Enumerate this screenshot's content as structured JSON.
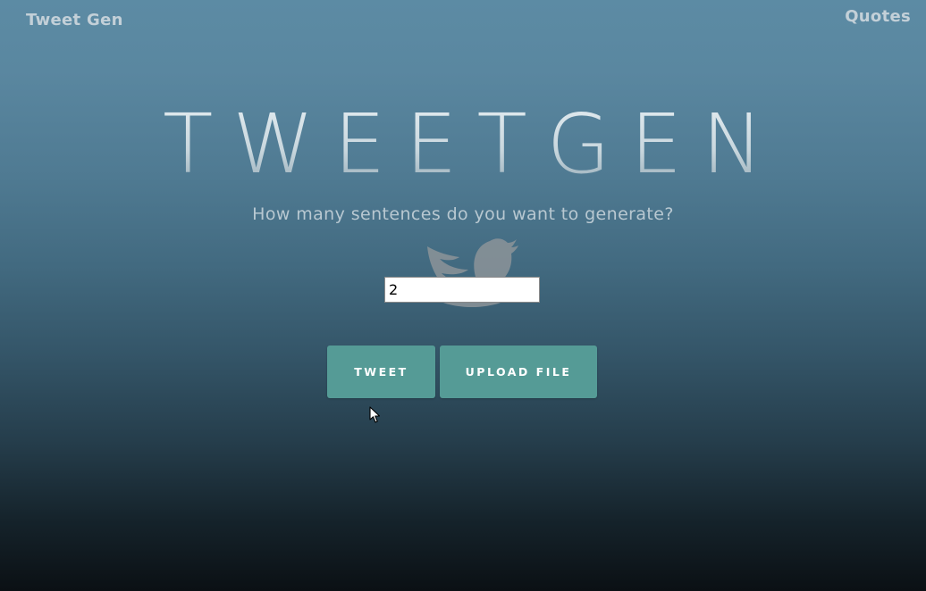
{
  "nav": {
    "brand": "Tweet Gen",
    "link": "Quotes"
  },
  "hero": {
    "title": "TWEETGEN",
    "subtitle": "How many sentences do you want to generate?"
  },
  "form": {
    "count_value": "2"
  },
  "buttons": {
    "tweet_label": "TWEET",
    "upload_label": "UPLOAD FILE"
  },
  "icons": {
    "logo": "twitter-bird-icon",
    "pointer": "mouse-cursor-icon"
  },
  "colors": {
    "button": "#559b96",
    "nav_text": "#c3d0d8",
    "background_top": "#5c8ba4",
    "background_bottom": "#0b1014"
  }
}
